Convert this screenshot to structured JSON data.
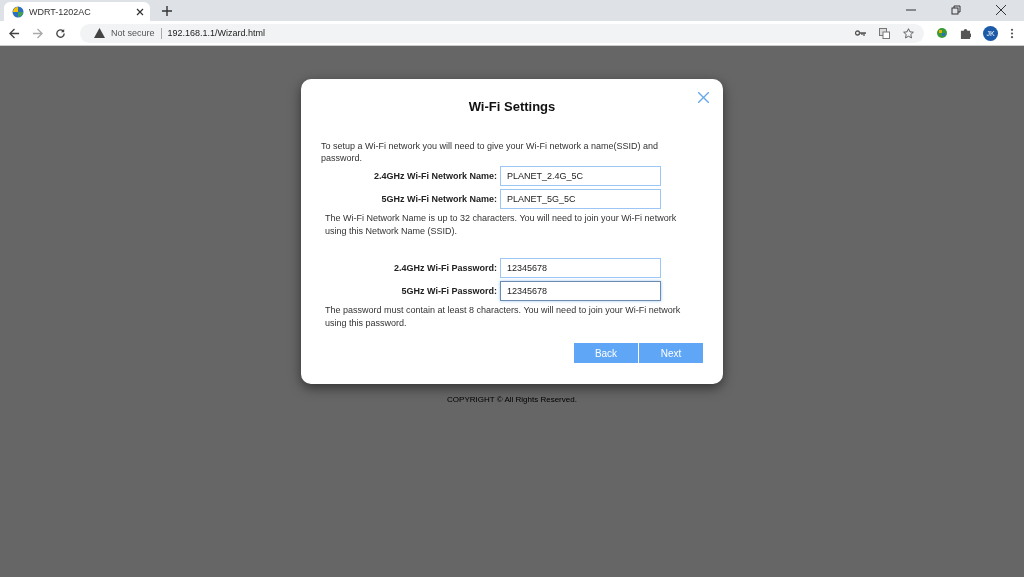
{
  "browser": {
    "tab_title": "WDRT-1202AC",
    "security": "Not secure",
    "url": "192.168.1.1/Wizard.html",
    "profile": "JK"
  },
  "dialog": {
    "title": "Wi-Fi Settings",
    "intro": "To setup a Wi-Fi network you will need to give your Wi-Fi network a name(SSID) and password.",
    "name_fields": [
      {
        "label": "2.4GHz Wi-Fi Network Name:",
        "value": "PLANET_2.4G_5C",
        "focused": false
      },
      {
        "label": "5GHz Wi-Fi Network Name:",
        "value": "PLANET_5G_5C",
        "focused": false
      }
    ],
    "name_note": "The Wi-Fi Network Name is up to 32 characters. You will need to join your Wi-Fi network using this Network Name (SSID).",
    "password_fields": [
      {
        "label": "2.4GHz Wi-Fi Password:",
        "value": "12345678",
        "focused": false
      },
      {
        "label": "5GHz Wi-Fi Password:",
        "value": "12345678",
        "focused": true
      }
    ],
    "password_note": "The password must contain at least 8 characters. You will need to join your Wi-Fi network using this password.",
    "buttons": [
      "Back",
      "Next"
    ]
  },
  "footer": "COPYRIGHT © All Rights Reserved."
}
